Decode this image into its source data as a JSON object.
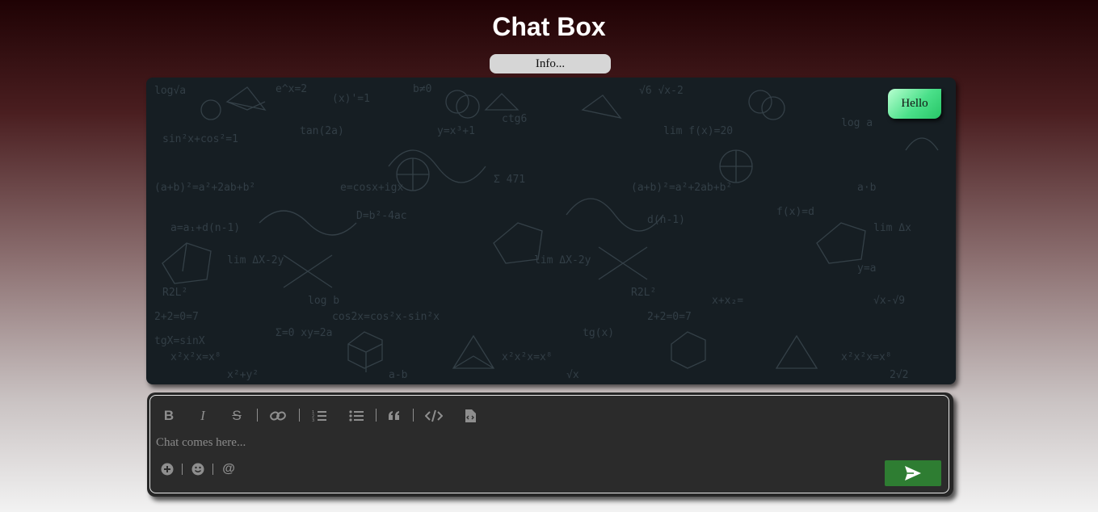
{
  "header": {
    "title": "Chat Box"
  },
  "info_button": {
    "label": "Info..."
  },
  "messages": [
    {
      "text": "Hello",
      "side": "right"
    }
  ],
  "composer": {
    "placeholder": "Chat comes here...",
    "toolbar": [
      {
        "name": "bold-icon",
        "glyph": "B"
      },
      {
        "name": "italic-icon",
        "glyph": "I"
      },
      {
        "name": "strikethrough-icon",
        "glyph": "S"
      },
      {
        "name": "link-icon"
      },
      {
        "name": "ordered-list-icon"
      },
      {
        "name": "bullet-list-icon"
      },
      {
        "name": "blockquote-icon"
      },
      {
        "name": "code-icon"
      },
      {
        "name": "code-block-icon"
      }
    ],
    "bottom_actions": [
      {
        "name": "add-icon"
      },
      {
        "name": "emoji-icon"
      },
      {
        "name": "mention-icon",
        "glyph": "@"
      }
    ],
    "send_icon": "send-icon"
  },
  "colors": {
    "send_button": "#2e7d32",
    "bubble_green": "#4be08a",
    "composer_bg": "#2b2b2b",
    "chat_bg": "#161e23"
  }
}
